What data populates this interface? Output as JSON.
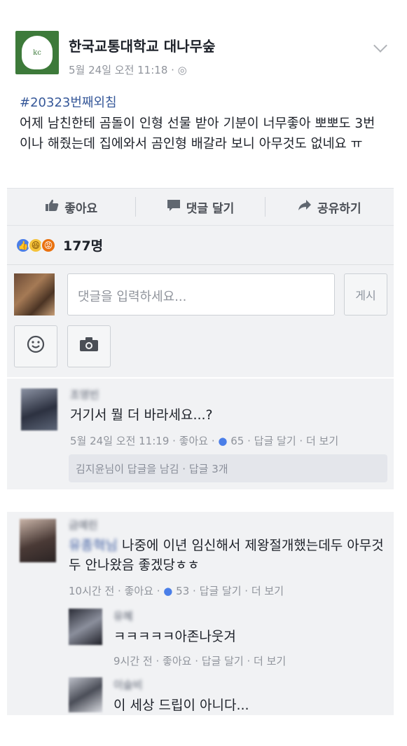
{
  "post": {
    "page_name": "한국교통대학교 대나무숲",
    "page_logo_text": "kc",
    "meta": "5월 24일 오전 11:18 · ◎",
    "hashtag": "#20323번째외침",
    "text": "어제 남친한테 곰돌이 인형 선물 받아 기분이 너무좋아 뽀뽀도 3번이나 해줬는데 집에와서 곰인형 배갈라 보니 아무것도 없네요 ㅠ"
  },
  "actions": {
    "like": "좋아요",
    "comment": "댓글 달기",
    "share": "공유하기"
  },
  "reactions": {
    "count": "177명",
    "types": [
      "like-icon",
      "haha-icon",
      "angry-icon"
    ]
  },
  "composer": {
    "placeholder": "댓글을 입력하세요...",
    "post_label": "게시"
  },
  "comments": [
    {
      "name": "조영빈",
      "text": "거기서 뭘 더 바라세요...?",
      "time": "5월 24일 오전 11:19 · ",
      "like": "좋아요",
      "reactions": "65",
      "reply": "답글 달기",
      "more": "더 보기",
      "reply_summary": "김지윤님이 답글을 남김 · 답글 3개"
    },
    {
      "name": "금예린",
      "tagged": "유종혁님",
      "text": "나중에 이년 임신해서 제왕절개했는데두 아무것두 안나왔음 좋겠당ㅎㅎ",
      "time": "10시간 전 · ",
      "like": "좋아요",
      "reactions": "53",
      "reply": "답글 달기",
      "more": "더 보기"
    },
    {
      "name": "유혜",
      "text": "ㅋㅋㅋㅋㅋ아존나웃겨",
      "time": "9시간 전 · ",
      "like": "좋아요",
      "reply": "답글 달기",
      "more": "더 보기"
    },
    {
      "name": "이슬비",
      "text": "이 세상 드립이 아니다..."
    }
  ]
}
